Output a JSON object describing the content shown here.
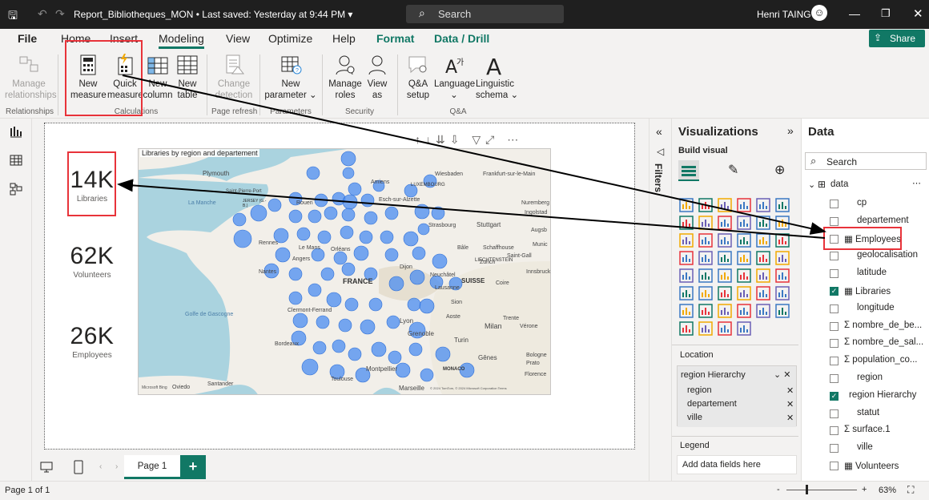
{
  "titlebar": {
    "filename": "Report_Bibliotheques_MON • Last saved: Yesterday at 9:44 PM ▾",
    "search": "Search",
    "user": "Henri TAING"
  },
  "menu": {
    "file": "File",
    "home": "Home",
    "insert": "Insert",
    "modeling": "Modeling",
    "view": "View",
    "optimize": "Optimize",
    "help": "Help",
    "format": "Format",
    "data_drill": "Data / Drill",
    "share": "Share"
  },
  "ribbon": {
    "manage_rel": [
      "Manage",
      "relationships"
    ],
    "new_measure": [
      "New",
      "measure"
    ],
    "quick_measure": [
      "Quick",
      "measure"
    ],
    "new_column": [
      "New",
      "column"
    ],
    "new_table": [
      "New",
      "table"
    ],
    "change_detection": [
      "Change",
      "detection"
    ],
    "new_parameter": [
      "New",
      "parameter ⌄"
    ],
    "manage_roles": [
      "Manage",
      "roles"
    ],
    "view_as": [
      "View",
      "as"
    ],
    "qa_setup": [
      "Q&A",
      "setup"
    ],
    "language": [
      "Language",
      "⌄"
    ],
    "linguistic": [
      "Linguistic",
      "schema ⌄"
    ],
    "groups": {
      "relationships": "Relationships",
      "calculations": "Calculations",
      "page_refresh": "Page refresh",
      "parameters": "Parameters",
      "security": "Security",
      "qa": "Q&A"
    }
  },
  "cards": [
    {
      "value": "14K",
      "label": "Libraries"
    },
    {
      "value": "62K",
      "label": "Volunteers"
    },
    {
      "value": "26K",
      "label": "Employees"
    }
  ],
  "map": {
    "title": "Libraries by region and departement",
    "labels": {
      "france": "FRANCE",
      "suisse": "SUISSE",
      "la_manche": "La Manche",
      "golfe": "Golfe de Gascogne",
      "luxembourg": "LUXEMBOURG",
      "liechtenstein": "LIECHTENSTEIN",
      "monaco": "MONACO",
      "jersey": "JERSEY (G.-B.)",
      "plymouth": "Plymouth",
      "saint_pierre": "Saint-Pierre-Port",
      "amiens": "Amiens",
      "rouen": "Rouen",
      "wiesbaden": "Wiesbaden",
      "frankfurt": "Frankfurt-sur-le-Main",
      "esch": "Esch-sur-Alzette",
      "nuremberg": "Nuremberg",
      "ingolstadt": "Ingolstad",
      "augsburg": "Augsb",
      "strasbourg": "Strasbourg",
      "stuttgart": "Stuttgart",
      "schaffhouse": "Schaffhouse",
      "saint_gall": "Saint-Gall",
      "munich": "Munic",
      "rennes": "Rennes",
      "le_mans": "Le Mans",
      "orleans": "Orléans",
      "angers": "Angers",
      "nantes": "Nantes",
      "dijon": "Dijon",
      "bale": "Bâle",
      "zurich": "Zurich",
      "innsbruck": "Innsbruck",
      "neuchatel": "Neuchâtel",
      "lausanne": "Lausanne",
      "coire": "Coire",
      "clermont": "Clermont-Ferrand",
      "lyon": "Lyon",
      "sion": "Sion",
      "trente": "Trente",
      "aoste": "Aoste",
      "milan": "Milan",
      "verone": "Vérone",
      "grenoble": "Grenoble",
      "turin": "Turin",
      "bordeaux": "Bordeaux",
      "bologne": "Bologne",
      "prato": "Prato",
      "genes": "Gênes",
      "florence": "Florence",
      "montpellier": "Montpellier",
      "toulouse": "Toulouse",
      "santander": "Santander",
      "oviedo": "Oviedo",
      "marseille": "Marseille",
      "credit": "© 2024 TomTom, © 2024 Microsoft Corporation Terms",
      "bing": "Microsoft Bing"
    }
  },
  "pages": {
    "page1": "Page 1",
    "add": "+"
  },
  "status": {
    "page": "Page 1 of 1",
    "zoom": "63%",
    "minus": "-",
    "plus": "+"
  },
  "filters": {
    "label": "Filters"
  },
  "viz": {
    "title": "Visualizations",
    "build": "Build visual",
    "location": "Location",
    "hierarchy": "region Hierarchy",
    "hier_items": [
      "region",
      "departement",
      "ville"
    ],
    "legend": "Legend",
    "add": "Add data fields here"
  },
  "data": {
    "title": "Data",
    "search": "Search",
    "table": "data",
    "fields": [
      {
        "name": "cp",
        "checked": false,
        "icon": ""
      },
      {
        "name": "departement",
        "checked": false,
        "icon": ""
      },
      {
        "name": "Employees",
        "checked": false,
        "icon": "calc"
      },
      {
        "name": "geolocalisation",
        "checked": false,
        "icon": ""
      },
      {
        "name": "latitude",
        "checked": false,
        "icon": ""
      },
      {
        "name": "Libraries",
        "checked": true,
        "icon": "calc"
      },
      {
        "name": "longitude",
        "checked": false,
        "icon": ""
      },
      {
        "name": "nombre_de_be...",
        "checked": false,
        "icon": "sigma"
      },
      {
        "name": "nombre_de_sal...",
        "checked": false,
        "icon": "sigma"
      },
      {
        "name": "population_co...",
        "checked": false,
        "icon": "sigma"
      },
      {
        "name": "region",
        "checked": false,
        "icon": ""
      },
      {
        "name": "region Hierarchy",
        "checked": true,
        "icon": "hier"
      },
      {
        "name": "statut",
        "checked": false,
        "icon": ""
      },
      {
        "name": "surface.1",
        "checked": false,
        "icon": "sigma"
      },
      {
        "name": "ville",
        "checked": false,
        "icon": ""
      },
      {
        "name": "Volunteers",
        "checked": false,
        "icon": "calc"
      }
    ]
  }
}
